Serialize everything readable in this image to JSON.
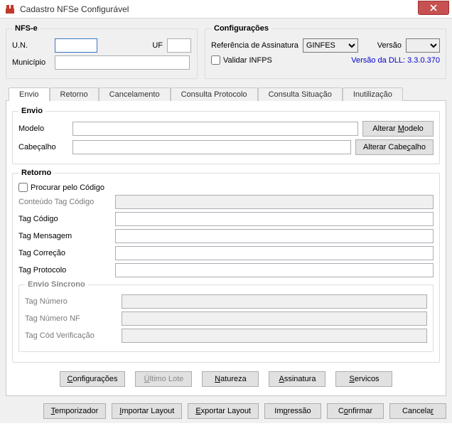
{
  "window": {
    "title": "Cadastro NFSe Configurável"
  },
  "nfse": {
    "legend": "NFS-e",
    "un_label": "U.N.",
    "un_value": "",
    "uf_label": "UF",
    "uf_value": "",
    "municipio_label": "Município",
    "municipio_value": ""
  },
  "config": {
    "legend": "Configurações",
    "ref_label": "Referência de Assinatura",
    "ref_value": "GINFES",
    "versao_label": "Versão",
    "versao_value": "",
    "validar_label": "Validar INFPS",
    "dll_version": "Versão da DLL: 3.3.0.370"
  },
  "tabs": [
    {
      "label": "Envio"
    },
    {
      "label": "Retorno"
    },
    {
      "label": "Cancelamento"
    },
    {
      "label": "Consulta Protocolo"
    },
    {
      "label": "Consulta Situação"
    },
    {
      "label": "Inutilização"
    }
  ],
  "envio": {
    "legend": "Envio",
    "modelo_label": "Modelo",
    "modelo_value": "",
    "cabecalho_label": "Cabeçalho",
    "cabecalho_value": "",
    "alterar_modelo": "Alterar Modelo",
    "alterar_cabecalho": "Alterar Cabeçalho"
  },
  "retorno": {
    "legend": "Retorno",
    "procurar_label": "Procurar pelo Código",
    "conteudo_label": "Conteúdo Tag Código",
    "conteudo_value": "",
    "tag_codigo_label": "Tag Código",
    "tag_codigo_value": "",
    "tag_msg_label": "Tag Mensagem",
    "tag_msg_value": "",
    "tag_corr_label": "Tag Correção",
    "tag_corr_value": "",
    "tag_proto_label": "Tag Protocolo",
    "tag_proto_value": ""
  },
  "sincrono": {
    "legend": "Envio Síncrono",
    "tag_numero_label": "Tag Número",
    "tag_numero_value": "",
    "tag_numero_nf_label": "Tag Número NF",
    "tag_numero_nf_value": "",
    "tag_cod_verif_label": "Tag Cód Verificação",
    "tag_cod_verif_value": ""
  },
  "buttons1": {
    "configuracoes": "Configurações",
    "ultimo_lote": "Último Lote",
    "natureza": "Natureza",
    "assinatura": "Assinatura",
    "servicos": "Servicos"
  },
  "buttons2": {
    "temporizador": "Temporizador",
    "importar": "Importar Layout",
    "exportar": "Exportar Layout",
    "impressao": "Impressão",
    "confirmar": "Confirmar",
    "cancelar": "Cancelar"
  }
}
